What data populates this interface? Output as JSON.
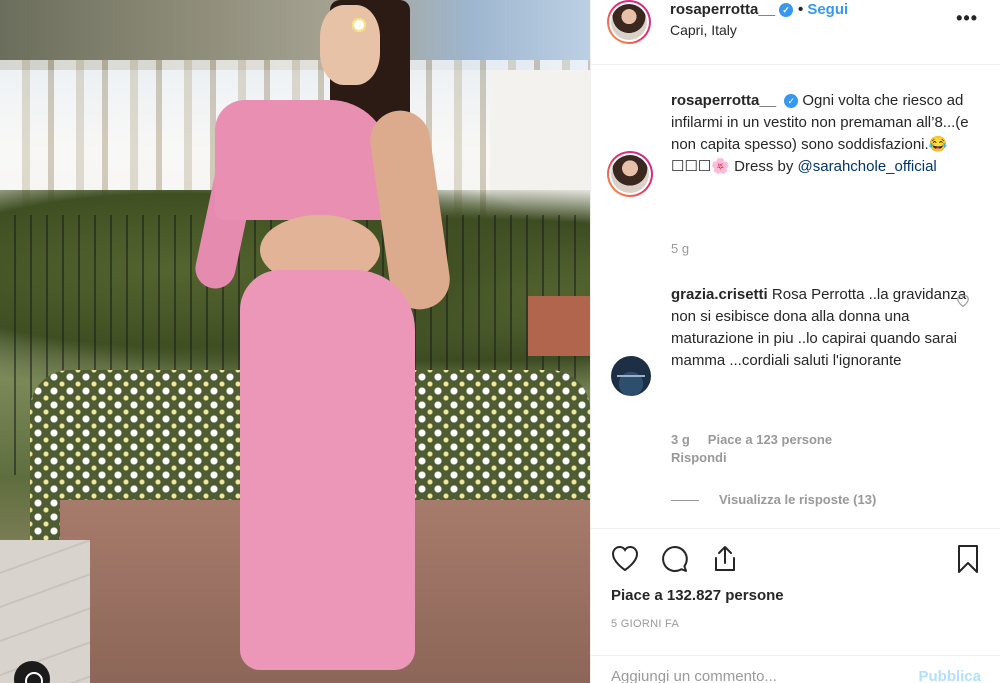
{
  "post": {
    "image_alt": "Donna con abito rosa su una terrazza a Capri",
    "has_tagged_users_badge": true
  },
  "header": {
    "username": "rosaperrotta__",
    "verified_mark": "✓",
    "dot": "•",
    "follow_label": "Segui",
    "location": "Capri, Italy",
    "more_label": "•••"
  },
  "caption": {
    "username": "rosaperrotta__",
    "text": "Ogni volta che riesco ad infilarmi in un vestito non premaman all’8...(e non capita spesso) sono soddisfazioni.😂☐☐☐🌸 Dress by ",
    "mention": "@sarahchole_official",
    "time": "5 g"
  },
  "comments": [
    {
      "username": "grazia.crisetti",
      "text": "Rosa Perrotta ..la gravidanza non si esibisce dona alla donna una maturazione in piu ..lo capirai quando sarai mamma ...cordiali saluti l'ignorante",
      "time": "3 g",
      "likes": "Piace a 123 persone",
      "reply_label": "Rispondi",
      "view_replies": "Visualizza le risposte (13)"
    }
  ],
  "actions": {
    "likes_text": "Piace a 132.827 persone",
    "time_ago": "5 GIORNI FA"
  },
  "add_comment": {
    "placeholder": "Aggiungi un commento...",
    "publish_label": "Pubblica"
  },
  "colors": {
    "accent": "#3897f0",
    "publish_disabled": "#b2dffc",
    "muted": "#999999"
  },
  "icons": [
    "heart-icon",
    "comment-icon",
    "share-icon",
    "bookmark-icon",
    "heart-small-icon",
    "verified-icon",
    "more-icon",
    "tagged-users-icon"
  ]
}
